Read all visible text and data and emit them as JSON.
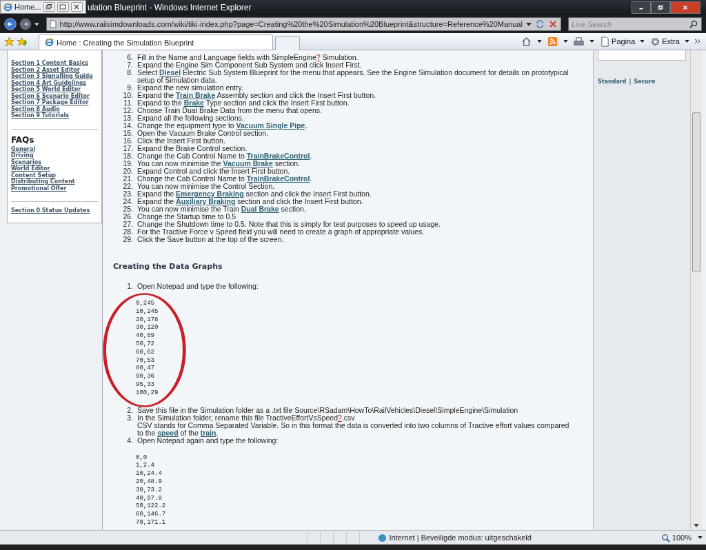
{
  "thumbnail": {
    "title": "Home..."
  },
  "window": {
    "title": "ulation Blueprint - Windows Internet Explorer"
  },
  "address_bar": {
    "url": "http://www.railsimdownloads.com/wiki/tiki-index.php?page=Creating%20the%20Simulation%20Blueprint&structure=Reference%20Manual"
  },
  "search": {
    "placeholder": "Live Search"
  },
  "tabs": [
    {
      "label": "Home : Creating the Simulation Blueprint",
      "selected": true
    }
  ],
  "commands": [
    "Pagina",
    "Extra"
  ],
  "sidebar": {
    "sections": [
      {
        "items": [
          "Section 1 Content Basics",
          "Section 2 Asset Editor",
          "Section 3 Signalling Guide",
          "Section 4 Art Guidelines",
          "Section 5 World Editor",
          "Section 6 Scenario Editor",
          "Section 7 Package Editor",
          "Section 8 Audio",
          "Section 9 Tutorials"
        ]
      },
      {
        "heading": "FAQs",
        "items": [
          "General",
          "Driving",
          "Scenarios",
          "World Editor",
          "Content Setup",
          "Distributing Content",
          "Promotional Offer"
        ]
      },
      {
        "items": [
          "Section 0 Status Updates"
        ]
      }
    ]
  },
  "steps": [
    {
      "number": "6.",
      "parts": [
        {
          "kind": "text",
          "text": "Fill in the Name and Language fields with SimpleEngine"
        },
        {
          "kind": "missing",
          "text": "?"
        },
        {
          "kind": "text",
          "text": " Simulation."
        }
      ]
    },
    {
      "number": "7.",
      "parts": [
        {
          "kind": "text",
          "text": "Expand the Engine Sim Component Sub System and click Insert First."
        }
      ]
    },
    {
      "number": "8.",
      "parts": [
        {
          "kind": "text",
          "text": "Select "
        },
        {
          "kind": "link",
          "text": "Diesel"
        },
        {
          "kind": "text",
          "text": " Electric Sub System Blueprint for the menu that appears. See the Engine Simulation document for details on prototypical setup of Simulation data."
        }
      ]
    },
    {
      "number": "9.",
      "parts": [
        {
          "kind": "text",
          "text": "Expand the new simulation entry."
        }
      ]
    },
    {
      "number": "10.",
      "parts": [
        {
          "kind": "text",
          "text": "Expand the "
        },
        {
          "kind": "link",
          "text": "Train Brake"
        },
        {
          "kind": "text",
          "text": " Assembly section and click the Insert First button."
        }
      ]
    },
    {
      "number": "11.",
      "parts": [
        {
          "kind": "text",
          "text": "Expand to the "
        },
        {
          "kind": "link",
          "text": "Brake"
        },
        {
          "kind": "text",
          "text": " Type section and click the Insert First button."
        }
      ]
    },
    {
      "number": "12.",
      "parts": [
        {
          "kind": "text",
          "text": "Choose Train Dual Brake Data from the menu that opens."
        }
      ]
    },
    {
      "number": "13.",
      "parts": [
        {
          "kind": "text",
          "text": "Expand all the following sections."
        }
      ]
    },
    {
      "number": "14.",
      "parts": [
        {
          "kind": "text",
          "text": "Change the equipment type to "
        },
        {
          "kind": "link",
          "text": "Vacuum Single Pipe"
        },
        {
          "kind": "text",
          "text": "."
        }
      ]
    },
    {
      "number": "15.",
      "parts": [
        {
          "kind": "text",
          "text": "Open the Vacuum Brake Control section."
        }
      ]
    },
    {
      "number": "16.",
      "parts": [
        {
          "kind": "text",
          "text": "Click the Insert First button."
        }
      ]
    },
    {
      "number": "17.",
      "parts": [
        {
          "kind": "text",
          "text": "Expand the Brake Control section."
        }
      ]
    },
    {
      "number": "18.",
      "parts": [
        {
          "kind": "text",
          "text": "Change the Cab Control Name to "
        },
        {
          "kind": "link",
          "text": "TrainBrakeControl"
        },
        {
          "kind": "text",
          "text": "."
        }
      ]
    },
    {
      "number": "19.",
      "parts": [
        {
          "kind": "text",
          "text": "You can now minimise the "
        },
        {
          "kind": "link",
          "text": "Vacuum Brake"
        },
        {
          "kind": "text",
          "text": " section."
        }
      ]
    },
    {
      "number": "20.",
      "parts": [
        {
          "kind": "text",
          "text": "Expand Control and click the Insert First button."
        }
      ]
    },
    {
      "number": "21.",
      "parts": [
        {
          "kind": "text",
          "text": "Change the Cab Control Name to "
        },
        {
          "kind": "link",
          "text": "TrainBrakeControl"
        },
        {
          "kind": "text",
          "text": "."
        }
      ]
    },
    {
      "number": "22.",
      "parts": [
        {
          "kind": "text",
          "text": "You can now minimise the Control Section."
        }
      ]
    },
    {
      "number": "23.",
      "parts": [
        {
          "kind": "text",
          "text": "Expand the "
        },
        {
          "kind": "link",
          "text": "Emergency Braking"
        },
        {
          "kind": "text",
          "text": " section and click the Insert First button."
        }
      ]
    },
    {
      "number": "24.",
      "parts": [
        {
          "kind": "text",
          "text": "Expand the "
        },
        {
          "kind": "link",
          "text": "Auxiliary Braking"
        },
        {
          "kind": "text",
          "text": " section and click the Insert First button."
        }
      ]
    },
    {
      "number": "25.",
      "parts": [
        {
          "kind": "text",
          "text": "You can now minimise the Train "
        },
        {
          "kind": "link",
          "text": "Dual Brake"
        },
        {
          "kind": "text",
          "text": " section."
        }
      ]
    },
    {
      "number": "26.",
      "parts": [
        {
          "kind": "text",
          "text": "Change the Startup time to 0.5"
        }
      ]
    },
    {
      "number": "27.",
      "parts": [
        {
          "kind": "text",
          "text": "Change the Shutdown time to 0.5. Note that this is simply for test purposes to speed up usage."
        }
      ]
    },
    {
      "number": "28.",
      "parts": [
        {
          "kind": "text",
          "text": "For the Tractive Force v Speed field you will need to create a graph of appropriate values."
        }
      ]
    },
    {
      "number": "29.",
      "parts": [
        {
          "kind": "text",
          "text": "Click the Save button at the top of the screen."
        }
      ]
    }
  ],
  "section_heading": "Creating the Data Graphs",
  "graph_steps": [
    {
      "number": "1.",
      "parts": [
        {
          "kind": "text",
          "text": "Open Notepad and type the following:"
        }
      ],
      "code": [
        "0,245",
        "10,245",
        "20,178",
        "30,120",
        "40,89",
        "50,72",
        "60,62",
        "70,53",
        "80,47",
        "90,36",
        "95,33",
        "100,29"
      ],
      "circled": true
    },
    {
      "number": "2.",
      "parts": [
        {
          "kind": "text",
          "text": "Save this file in the Simulation folder as a .txt file Source\\RSadam\\HowTo\\RailVehicles\\Diesel\\SimpleEngine\\Simulation"
        }
      ]
    },
    {
      "number": "3.",
      "parts": [
        {
          "kind": "text",
          "text": "In the Simulation folder, rename this file TractiveEffortVsSpeed"
        },
        {
          "kind": "missing",
          "text": "?"
        },
        {
          "kind": "text",
          "text": ".csv"
        }
      ],
      "note": [
        {
          "kind": "text",
          "text": "CSV stands for Comma Separated Variable. So in this format the data is converted into two columns of Tractive effort values compared to the "
        },
        {
          "kind": "link",
          "text": "speed"
        },
        {
          "kind": "text",
          "text": " of the "
        },
        {
          "kind": "link",
          "text": "train"
        },
        {
          "kind": "text",
          "text": "."
        }
      ]
    },
    {
      "number": "4.",
      "parts": [
        {
          "kind": "text",
          "text": "Open Notepad again and type the following:"
        }
      ],
      "code": [
        "0,0",
        "1,2.4",
        "10,24.4",
        "20,48.9",
        "30,73.2",
        "40,97.8",
        "50,122.2",
        "60,146.7",
        "70,171.1"
      ],
      "circled": false
    }
  ],
  "right_panel": {
    "links": [
      "Standard",
      "Secure"
    ],
    "separator": "|"
  },
  "status_bar": {
    "zone": "Internet | Beveiligde modus: uitgeschakeld",
    "zoom": "100%"
  }
}
